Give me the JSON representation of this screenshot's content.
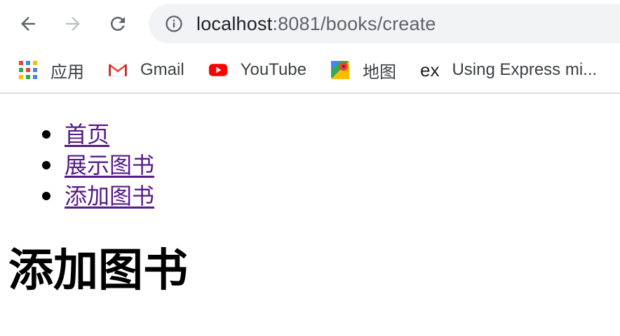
{
  "browser": {
    "url_host": "localhost",
    "url_path": ":8081/books/create",
    "bookmarks": [
      {
        "label": "应用",
        "icon": "apps-grid-icon"
      },
      {
        "label": "Gmail",
        "icon": "gmail-icon"
      },
      {
        "label": "YouTube",
        "icon": "youtube-icon"
      },
      {
        "label": "地图",
        "icon": "maps-icon"
      },
      {
        "label": "Using Express mi...",
        "icon": "express-icon",
        "icon_text": "ex"
      }
    ]
  },
  "page": {
    "nav_links": [
      {
        "label": "首页"
      },
      {
        "label": "展示图书"
      },
      {
        "label": "添加图书"
      }
    ],
    "heading": "添加图书"
  },
  "colors": {
    "link_visited": "#551a8b",
    "omnibox_bg": "#f1f3f4",
    "bookmark_text": "#3c4043"
  }
}
